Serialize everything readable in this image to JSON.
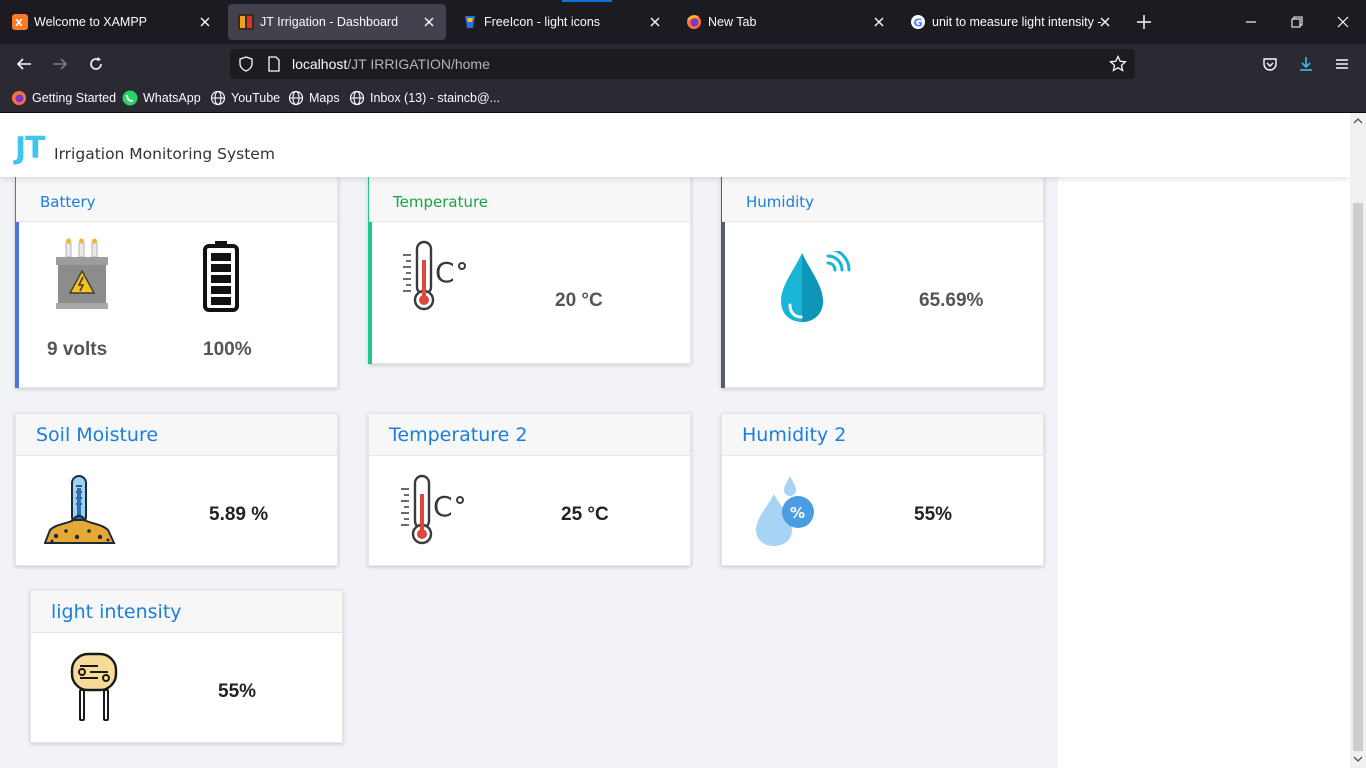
{
  "browser": {
    "tabs": [
      {
        "label": "Welcome to XAMPP",
        "icon": "xampp-icon"
      },
      {
        "label": "JT Irrigation - Dashboard",
        "icon": "jt-favicon"
      },
      {
        "label": "FreeIcon - light icons",
        "icon": "freeicon-favicon"
      },
      {
        "label": "New Tab",
        "icon": "firefox-icon"
      },
      {
        "label": "unit to measure light intensity -",
        "icon": "google-icon"
      }
    ],
    "url_host": "localhost",
    "url_path": "/JT IRRIGATION/home",
    "bookmarks": [
      {
        "label": "Getting Started",
        "icon": "firefox-icon"
      },
      {
        "label": "WhatsApp",
        "icon": "whatsapp-icon"
      },
      {
        "label": "YouTube",
        "icon": "globe-icon"
      },
      {
        "label": "Maps",
        "icon": "globe-icon"
      },
      {
        "label": "Inbox (13) - staincb@...",
        "icon": "globe-icon"
      }
    ]
  },
  "app": {
    "brand_short": "JT",
    "brand_name": "Irrigation Monitoring System"
  },
  "cards": {
    "battery": {
      "title": "Battery",
      "voltage": "9 volts",
      "level": "100%",
      "accent": "#4e73df"
    },
    "temperature": {
      "title": "Temperature",
      "value": "20 °C",
      "accent": "#1cc88a",
      "title_color": "#1aa34a"
    },
    "humidity": {
      "title": "Humidity",
      "value": "65.69%",
      "accent": "#5a5c69"
    },
    "soil": {
      "title": "Soil Moisture",
      "value": "5.89 %"
    },
    "temperature2": {
      "title": "Temperature 2",
      "value": "25 °C"
    },
    "humidity2": {
      "title": "Humidity 2",
      "value": "55%"
    },
    "light": {
      "title": "light intensity",
      "value": "55%"
    }
  },
  "colors": {
    "title_blue": "#1a7ee0",
    "brand_cyan": "#3ec7ea"
  }
}
